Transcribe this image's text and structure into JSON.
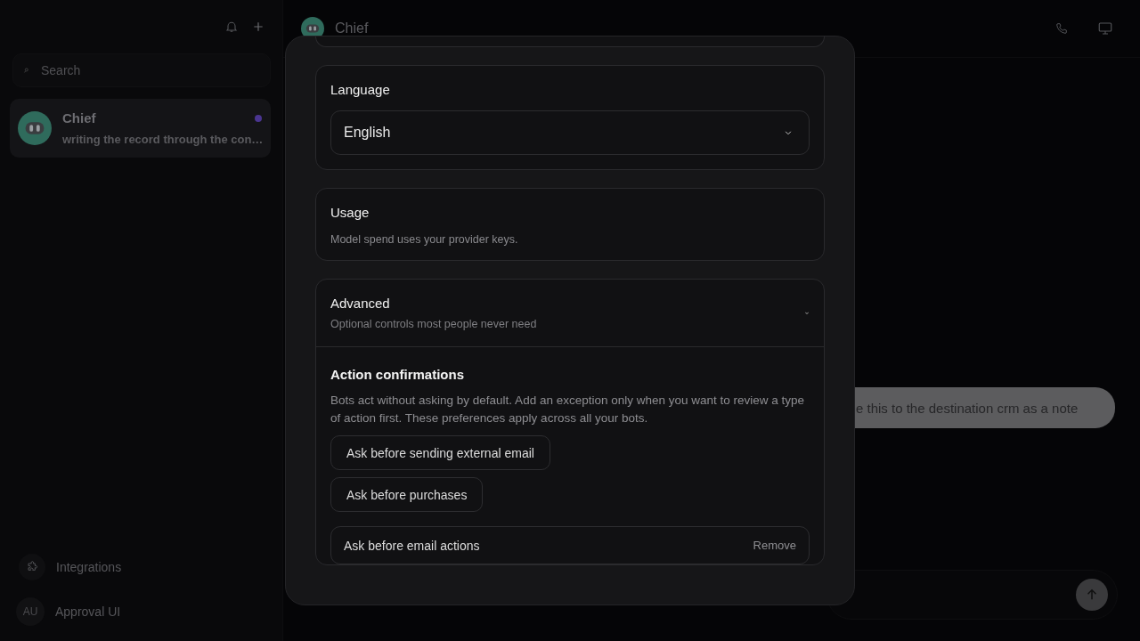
{
  "sidebar": {
    "search": {
      "placeholder": "Search"
    },
    "chats": [
      {
        "name": "Chief",
        "preview": "writing the record through the con…",
        "unread": true,
        "selected": true
      }
    ],
    "footer": [
      {
        "kind": "link",
        "label": "Integrations"
      },
      {
        "kind": "user",
        "initials": "AU",
        "label": "Approval UI"
      }
    ]
  },
  "chat": {
    "title": "Chief",
    "messages": [
      {
        "text": "e this to the destination crm as a note"
      }
    ]
  },
  "settings": {
    "language": {
      "title": "Language",
      "value": "English"
    },
    "usage": {
      "title": "Usage",
      "note": "Model spend uses your provider keys."
    },
    "advanced": {
      "title": "Advanced",
      "subtitle": "Optional controls most people never need",
      "expanded": true,
      "section_title": "Action confirmations",
      "description": "Bots act without asking by default. Add an exception only when you want to review a type of action first. These preferences apply across all your bots.",
      "suggestions": [
        "Ask before sending external email",
        "Ask before purchases"
      ],
      "rules": [
        {
          "label": "Ask before email actions",
          "action": "Remove"
        }
      ]
    }
  }
}
